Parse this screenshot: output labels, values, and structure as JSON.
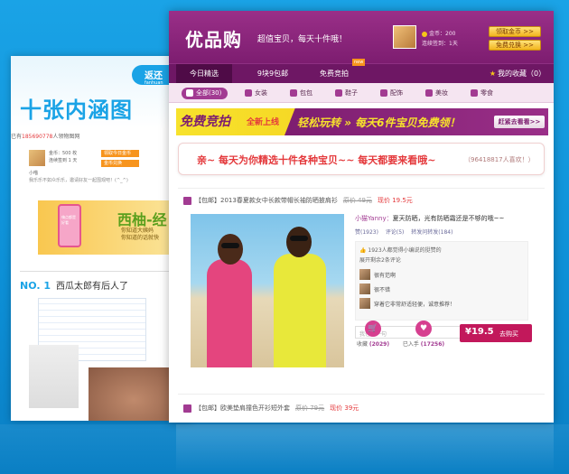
{
  "back": {
    "badge": "返还",
    "badge_sub": "fanhuan",
    "title": "十张内涵图",
    "line_prefix": "已有",
    "line_count": "185690778",
    "line_suffix": "人领物图网",
    "user_name": "小喵",
    "coin_text": "金币：500 枚",
    "signin_text": "连续签到 1 天",
    "orange_btn": "领取今日金币",
    "orange_btn2": "金币兑换",
    "msg": "我乐乐不如众乐乐，邀请好友一起围观吧！(^_^)",
    "banner_title": "西柚-经",
    "banner_sub1": "你知道大姨妈",
    "banner_sub2": "你知道的话就快",
    "phone_label": "嗨点都是好看",
    "section_num": "NO. 1",
    "section_title": "西瓜太郎有后人了"
  },
  "top": {
    "logo": "优品购",
    "slogan": "超值宝贝，每天十件哦！",
    "coin": "金币：200",
    "signin": "连续签到：1天",
    "btn_claim": "领取金币 >>",
    "btn_exchange": "免费兑换 >>"
  },
  "nav": {
    "items": [
      "今日精选",
      "9块9包邮",
      "免费竞拍"
    ],
    "new_badge": "new",
    "favorites": "我的收藏（0）"
  },
  "categories": [
    "全部(30)",
    "女装",
    "包包",
    "鞋子",
    "配饰",
    "美妆",
    "零食"
  ],
  "promo": {
    "left": "免费竞拍",
    "left_tag": "全新上线",
    "mid": "轻松玩转 » 每天6件宝贝免费领！",
    "btn": "赶紧去看看>>"
  },
  "slogan_box": {
    "main": "亲~ 每天为你精选十件各种宝贝~~ 每天都要来看哦~",
    "count": "（96418817人喜欢！）"
  },
  "item1": {
    "tag": "【包邮】",
    "title": "2013春夏款女中长款带帽长袖防晒披肩衫",
    "old_price": "原价 49元",
    "new_price": "现价 19.5元",
    "quote_user": "小猫Yanny：",
    "quote": "夏天防晒，光有防晒霜还是不够的哦~~",
    "stats": [
      "赞(1923)",
      "评论(5)",
      "转发问转发(184)"
    ],
    "like_line": "1923人都觉得小编说的挺赞的",
    "expand": "展开剩余2条评论",
    "comments": [
      "很有范啊",
      "很不错",
      "穿着它非常舒适轻便，诚意推荐！"
    ],
    "reply_placeholder": "我也说一句",
    "collect_label": "收藏",
    "collect_count": "(2029)",
    "bought_label": "已入手",
    "bought_count": "(17256)",
    "buy_price": "¥19.5",
    "buy_label": "去购买"
  },
  "item2": {
    "tag": "【包邮】",
    "title": "欧美垫肩撞色开衫短外套",
    "old_price": "原价 79元",
    "new_price": "现价 39元"
  }
}
